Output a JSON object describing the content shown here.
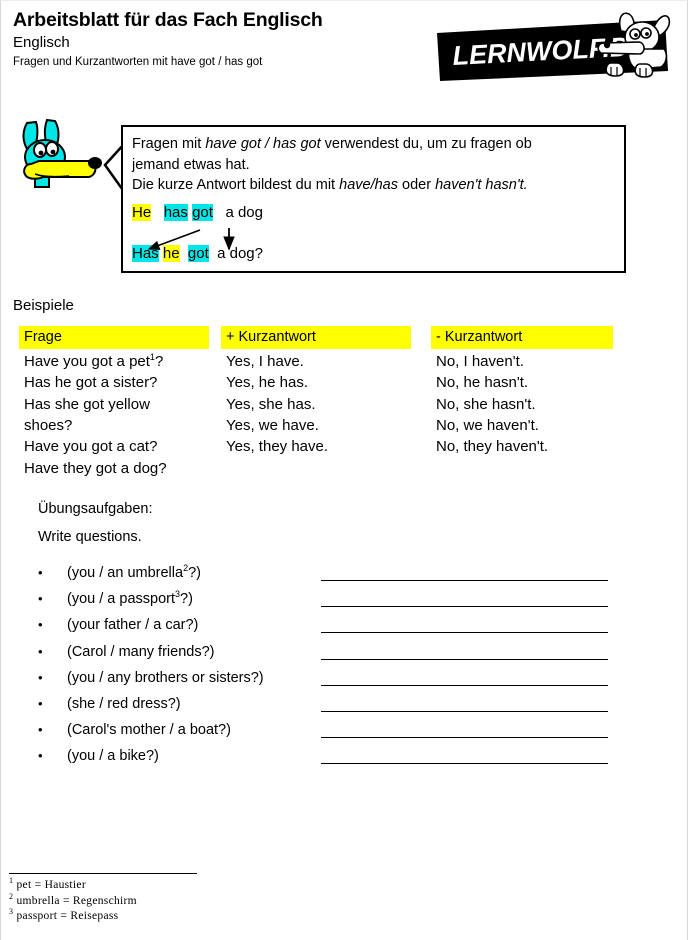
{
  "header": {
    "title": "Arbeitsblatt für das Fach Englisch",
    "subject": "Englisch",
    "topic": "Fragen und Kurzantworten mit have got / has got"
  },
  "logo": {
    "text": "LernWolf.de",
    "background_color": "#000000",
    "text_color": "#ffffff",
    "icon": "wolf-mascot-icon"
  },
  "mascot": {
    "icon": "dog-mascot-icon",
    "body_color": "#00e5e5",
    "snout_color": "#ffff00"
  },
  "explanation": {
    "line1_a": "Fragen mit ",
    "line1_italic": "have got / has got",
    "line1_b": " verwendest du, um zu fragen ob",
    "line2": "jemand etwas hat.",
    "line3_a": "Die kurze Antwort bildest du mit ",
    "line3_italic1": "have/has",
    "line3_b": " oder ",
    "line3_italic2": "haven't hasn't.",
    "example_statement": {
      "w1": "He",
      "w1_highlight": "#ffff00",
      "w2": "has",
      "w2_highlight": "#00e5e5",
      "w3": "got",
      "w3_highlight": "#00e5e5",
      "tail": "a dog"
    },
    "example_question": {
      "w1": "Has",
      "w1_highlight": "#00e5e5",
      "w2": "he",
      "w2_highlight": "#ffff00",
      "w3": "got",
      "w3_highlight": "#00e5e5",
      "tail": "a dog?"
    }
  },
  "examples": {
    "section_label": "Beispiele",
    "header_background": "#ffff00",
    "columns": [
      {
        "header": "Frage",
        "items": [
          "Have you got a pet",
          "Has he got a sister?",
          "Has she got yellow",
          "shoes?",
          "Have you got a cat?",
          "Have they got a dog?"
        ],
        "first_item_footnote": "1"
      },
      {
        "header": "+ Kurzantwort",
        "items": [
          "Yes, I have.",
          "Yes, he has.",
          "Yes, she has.",
          "Yes, we have.",
          "Yes, they have."
        ]
      },
      {
        "header": "- Kurzantwort",
        "items": [
          "No, I haven't.",
          "No, he hasn't.",
          "No, she hasn't.",
          "No, we haven't.",
          "No, they haven't."
        ]
      }
    ]
  },
  "exercises": {
    "label": "Übungsaufgaben:",
    "instruction": "Write questions.",
    "bullet_glyph": "•",
    "tasks": [
      {
        "text_before": "(you / an umbrella",
        "footnote": "2",
        "text_after": "?)"
      },
      {
        "text_before": "(you / a passport",
        "footnote": "3",
        "text_after": "?)"
      },
      {
        "text_before": "(your father / a car?)",
        "footnote": "",
        "text_after": ""
      },
      {
        "text_before": "(Carol / many friends?)",
        "footnote": "",
        "text_after": ""
      },
      {
        "text_before": "(you / any brothers or sisters?)",
        "footnote": "",
        "text_after": ""
      },
      {
        "text_before": "(she / red dress?)",
        "footnote": "",
        "text_after": ""
      },
      {
        "text_before": "(Carol's mother / a boat?)",
        "footnote": "",
        "text_after": ""
      },
      {
        "text_before": "(you / a bike?)",
        "footnote": "",
        "text_after": ""
      }
    ]
  },
  "footnotes": [
    {
      "marker": "1",
      "text": "pet = Haustier"
    },
    {
      "marker": "2",
      "text": "umbrella = Regenschirm"
    },
    {
      "marker": "3",
      "text": "passport = Reisepass"
    }
  ]
}
